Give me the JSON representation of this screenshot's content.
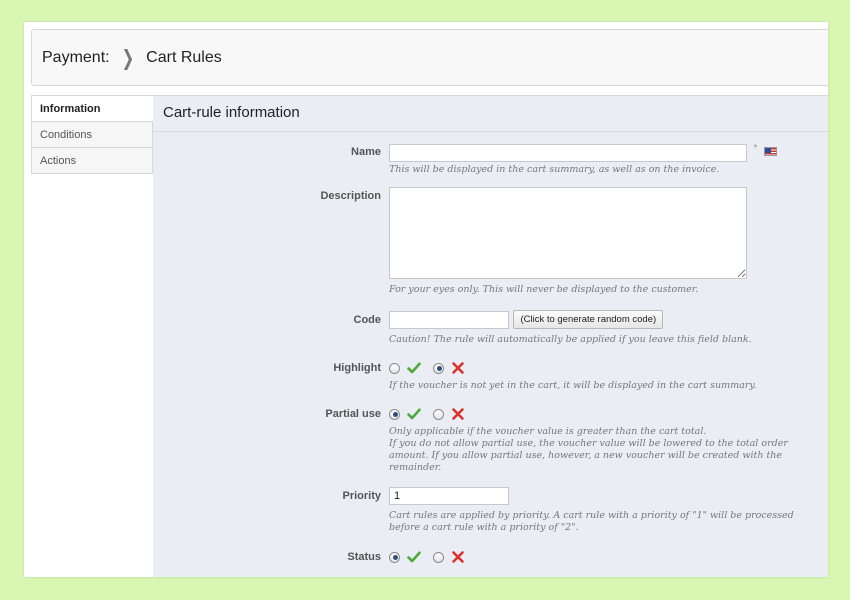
{
  "breadcrumb": {
    "parent": "Payment:",
    "current": "Cart Rules"
  },
  "sidebar": {
    "items": [
      {
        "label": "Information",
        "active": true
      },
      {
        "label": "Conditions",
        "active": false
      },
      {
        "label": "Actions",
        "active": false
      }
    ]
  },
  "panel": {
    "title": "Cart-rule information"
  },
  "form": {
    "name": {
      "label": "Name",
      "value": "",
      "required_mark": "*",
      "hint": "This will be displayed in the cart summary, as well as on the invoice."
    },
    "description": {
      "label": "Description",
      "value": "",
      "hint": "For your eyes only. This will never be displayed to the customer."
    },
    "code": {
      "label": "Code",
      "value": "",
      "button": "(Click to generate random code)",
      "hint": "Caution! The rule will automatically be applied if you leave this field blank."
    },
    "highlight": {
      "label": "Highlight",
      "selected": "no",
      "hint": "If the voucher is not yet in the cart, it will be displayed in the cart summary."
    },
    "partial_use": {
      "label": "Partial use",
      "selected": "yes",
      "hint_lines": [
        "Only applicable if the voucher value is greater than the cart total.",
        "If you do not allow partial use, the voucher value will be lowered to the total order amount. If you allow partial use, however, a new voucher will be created with the remainder."
      ]
    },
    "priority": {
      "label": "Priority",
      "value": "1",
      "hint": "Cart rules are applied by priority. A cart rule with a priority of \"1\" will be processed before a cart rule with a priority of \"2\"."
    },
    "status": {
      "label": "Status",
      "selected": "yes"
    }
  },
  "icons": {
    "yes": "check-icon",
    "no": "cross-icon",
    "language": "us-flag-icon"
  },
  "colors": {
    "yes": "#4caa3a",
    "no": "#d9322c",
    "page_background": "#d9f7b3",
    "panel": "#ebedf4"
  }
}
